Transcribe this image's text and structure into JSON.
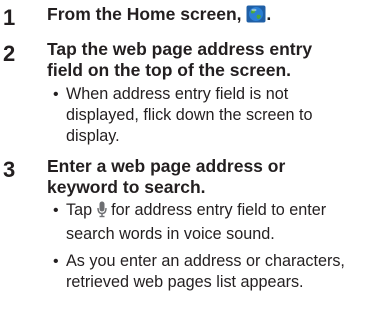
{
  "steps": [
    {
      "number": "1",
      "title_before_icon": "From the Home screen, ",
      "title_icon": "browser-globe-icon",
      "title_after_icon": ".",
      "bullets": []
    },
    {
      "number": "2",
      "title_line1": "Tap the web page address entry",
      "title_line2": "field on the top of the screen.",
      "bullets": [
        {
          "line1": "When address entry field is not",
          "line2": "displayed, flick down the screen to",
          "line3": "display."
        }
      ]
    },
    {
      "number": "3",
      "title_line1": "Enter a web page address or",
      "title_line2": "keyword to search.",
      "bullets": [
        {
          "line1_before_icon": "Tap ",
          "line1_icon": "microphone-icon",
          "line1_after_icon": " for address entry field to enter",
          "line2": "search words in voice sound."
        },
        {
          "line1": "As you enter an address or characters,",
          "line2": "retrieved web pages list appears."
        }
      ]
    }
  ],
  "bullet_symbol": "•",
  "colors": {
    "text": "#231f20",
    "globe_blue": "#2a7fd4",
    "globe_land": "#4aa83a",
    "mic_grey": "#6d6e71"
  }
}
